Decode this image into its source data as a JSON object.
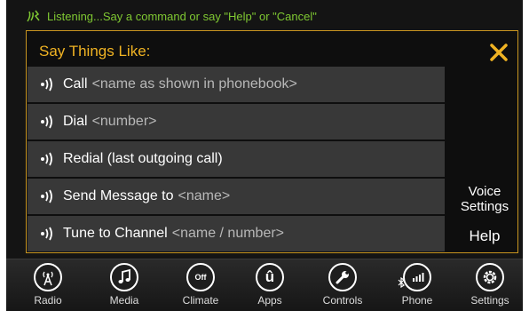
{
  "status": {
    "text": "Listening...Say a command or say \"Help\" or \"Cancel\"",
    "icon": "voice-listening-icon"
  },
  "panel": {
    "title": "Say Things Like:",
    "close_icon": "close-x-icon"
  },
  "commands": [
    {
      "command": "Call",
      "argument": "<name as shown in phonebook>"
    },
    {
      "command": "Dial",
      "argument": "<number>"
    },
    {
      "command": "Redial (last outgoing call)",
      "argument": ""
    },
    {
      "command": "Send Message to",
      "argument": "<name>"
    },
    {
      "command": "Tune to Channel",
      "argument": "<name / number>"
    }
  ],
  "side_buttons": {
    "voice_settings": "Voice Settings",
    "help": "Help"
  },
  "navbar": [
    {
      "label": "Radio",
      "icon": "radio-tower-icon"
    },
    {
      "label": "Media",
      "icon": "music-note-icon"
    },
    {
      "label": "Climate",
      "icon": "climate-off-icon",
      "icon_text": "Off"
    },
    {
      "label": "Apps",
      "icon": "apps-u-icon",
      "icon_text": "û"
    },
    {
      "label": "Controls",
      "icon": "wrench-icon"
    },
    {
      "label": "Phone",
      "icon": "phone-signal-icon"
    },
    {
      "label": "Settings",
      "icon": "gear-icon"
    }
  ],
  "colors": {
    "accent": "#f0b323",
    "status_green": "#7fc832",
    "panel_border": "#c89520",
    "row_bg": "#383838"
  }
}
